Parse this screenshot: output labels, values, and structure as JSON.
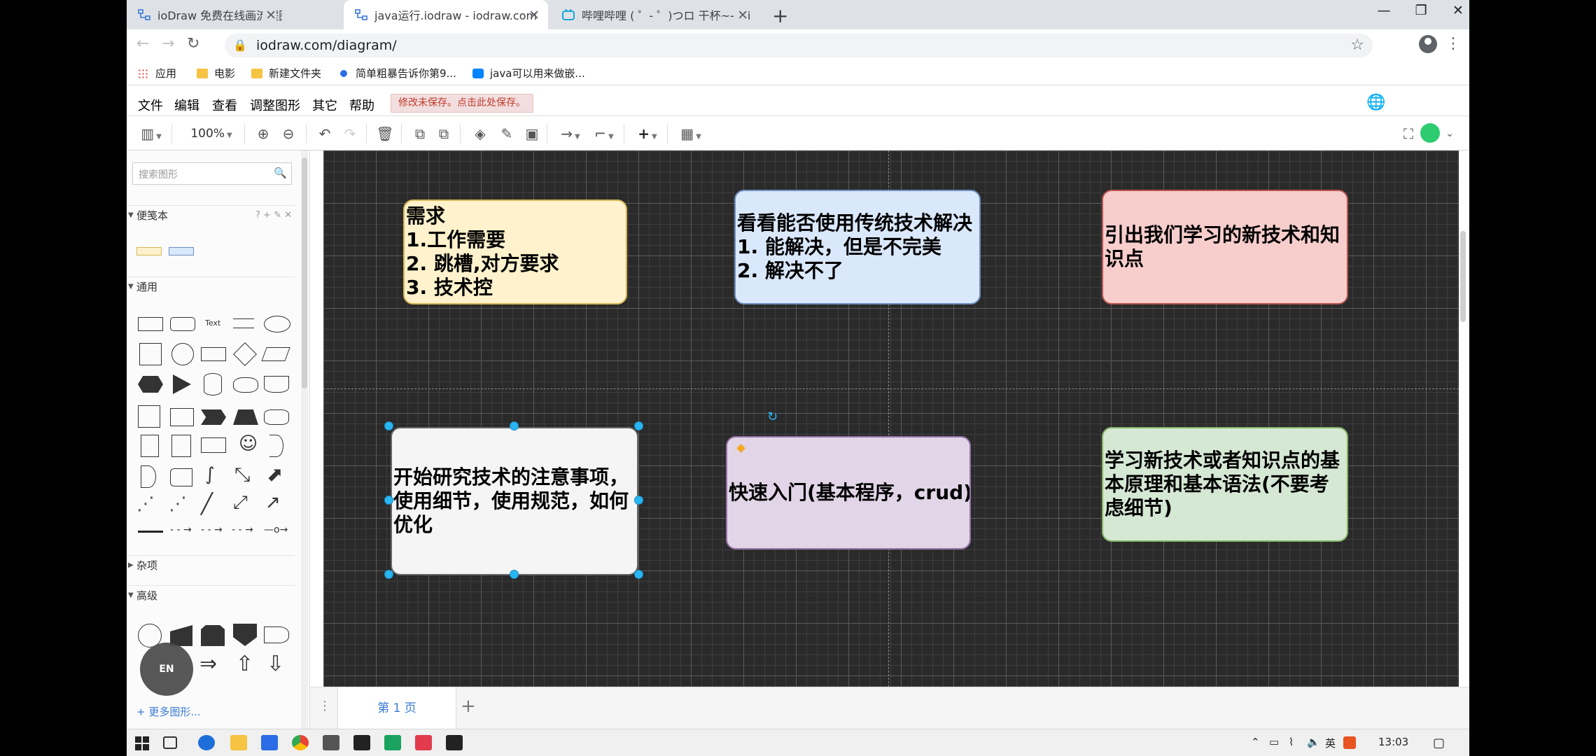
{
  "browser": {
    "tabs": [
      {
        "title": "ioDraw 免费在线画流程图、思维",
        "active": false
      },
      {
        "title": "java运行.iodraw - iodraw.com",
        "active": true
      },
      {
        "title": "哔哩哔哩 ( ゜- ゜)つロ 干杯~-bili",
        "active": false
      }
    ],
    "url": "iodraw.com/diagram/",
    "bookmarks": [
      "应用",
      "电影",
      "新建文件夹",
      "简单粗暴告诉你第9...",
      "java可以用来做嵌..."
    ]
  },
  "app": {
    "menu": [
      "文件",
      "编辑",
      "查看",
      "调整图形",
      "其它",
      "帮助"
    ],
    "unsaved_notice": "修改未保存。点击此处保存。",
    "zoom": "100%"
  },
  "sidebar": {
    "search_placeholder": "搜索图形",
    "sections": [
      "便笺本",
      "通用",
      "杂项",
      "高级"
    ],
    "text_shape_label": "Text",
    "more_shapes": "+ 更多图形...",
    "en_badge": "EN"
  },
  "diagram": {
    "nodes": [
      {
        "id": "n1",
        "lines": [
          "需求",
          "1.工作需要",
          "2. 跳槽,对方要求",
          "3. 技术控"
        ],
        "fill": "#fff2cc",
        "stroke": "#d6b656"
      },
      {
        "id": "n2",
        "lines": [
          "看看能否使用传统技术解决",
          "1. 能解决，但是不完美",
          "2. 解决不了"
        ],
        "fill": "#dae8fc",
        "stroke": "#6c8ebf"
      },
      {
        "id": "n3",
        "lines": [
          "引出我们学习的新技术和知",
          "识点"
        ],
        "fill": "#f8cecc",
        "stroke": "#b85450"
      },
      {
        "id": "n4",
        "lines": [
          "开始研究技术的注意事项，",
          "使用细节，使用规范，如何",
          "优化"
        ],
        "fill": "#f5f5f5",
        "stroke": "#666666"
      },
      {
        "id": "n5",
        "lines": [
          "快速入门(基本程序，crud)"
        ],
        "fill": "#e1d5e7",
        "stroke": "#9673a6"
      },
      {
        "id": "n6",
        "lines": [
          "学习新技术或者知识点的基",
          "本原理和基本语法(不要考",
          "虑细节)"
        ],
        "fill": "#d5e8d4",
        "stroke": "#82b366"
      }
    ]
  },
  "pages": {
    "current": "第 1 页"
  },
  "taskbar": {
    "ime": "英",
    "time": "13:03"
  }
}
